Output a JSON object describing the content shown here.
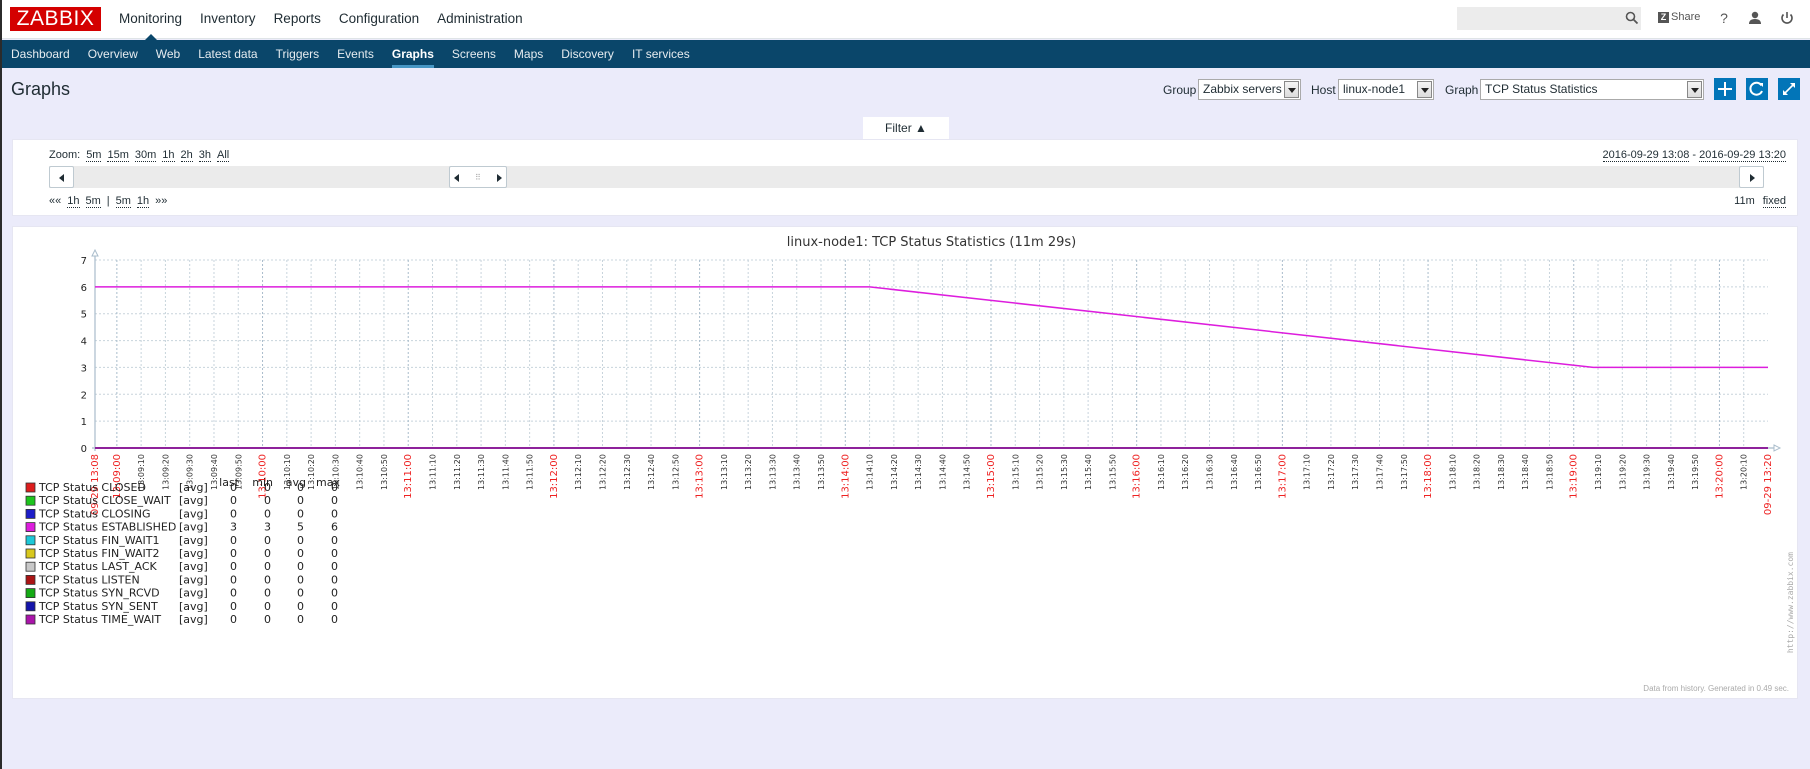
{
  "app": {
    "logo": "ZABBIX",
    "main_nav": [
      "Monitoring",
      "Inventory",
      "Reports",
      "Configuration",
      "Administration"
    ],
    "main_nav_active": "Monitoring",
    "search_placeholder": "",
    "share_label": "Share",
    "help_label": "?",
    "sub_nav": [
      "Dashboard",
      "Overview",
      "Web",
      "Latest data",
      "Triggers",
      "Events",
      "Graphs",
      "Screens",
      "Maps",
      "Discovery",
      "IT services"
    ],
    "sub_nav_active": "Graphs"
  },
  "page": {
    "title": "Graphs",
    "group_label": "Group",
    "group_value": "Zabbix servers",
    "host_label": "Host",
    "host_value": "linux-node1",
    "graph_label": "Graph",
    "graph_value": "TCP Status Statistics",
    "filter_label": "Filter ▲"
  },
  "timeline": {
    "zoom_label": "Zoom:",
    "zoom_options": [
      "5m",
      "15m",
      "30m",
      "1h",
      "2h",
      "3h",
      "All"
    ],
    "range_from": "2016-09-29 13:08",
    "range_sep": " - ",
    "range_to": "2016-09-29 13:20",
    "nav_back": [
      "««",
      "1h",
      "5m"
    ],
    "nav_sep": "|",
    "nav_fwd": [
      "5m",
      "1h",
      "»»"
    ],
    "period": "11m",
    "fixed_label": "fixed"
  },
  "chart_data": {
    "type": "line",
    "title": "linux-node1: TCP Status Statistics (11m 29s)",
    "xlabel": "",
    "ylabel": "",
    "ylim": [
      0,
      7
    ],
    "yticks": [
      0,
      1,
      2,
      3,
      4,
      5,
      6,
      7
    ],
    "x_start": "13:08:51",
    "x_end": "13:20:20",
    "x_start_label": "09-29 13:08",
    "x_end_label": "09-29 13:20",
    "x_tick_interval_seconds": 10,
    "grid": true,
    "series": [
      {
        "name": "TCP Status CLOSED",
        "func": "[avg]",
        "color": "#dd1d1d",
        "last": "0",
        "min": "0",
        "avg": "0",
        "max": "0",
        "points": [
          [
            "13:08:51",
            0
          ],
          [
            "13:20:20",
            0
          ]
        ]
      },
      {
        "name": "TCP Status CLOSE_WAIT",
        "func": "[avg]",
        "color": "#1dc51d",
        "last": "0",
        "min": "0",
        "avg": "0",
        "max": "0",
        "points": [
          [
            "13:08:51",
            0
          ],
          [
            "13:20:20",
            0
          ]
        ]
      },
      {
        "name": "TCP Status CLOSING",
        "func": "[avg]",
        "color": "#1d1dc8",
        "last": "0",
        "min": "0",
        "avg": "0",
        "max": "0",
        "points": [
          [
            "13:08:51",
            0
          ],
          [
            "13:20:20",
            0
          ]
        ]
      },
      {
        "name": "TCP Status ESTABLISHED",
        "func": "[avg]",
        "color": "#dd1ddd",
        "last": "3",
        "min": "3",
        "avg": "5",
        "max": "6",
        "points": [
          [
            "13:08:51",
            6
          ],
          [
            "13:14:10",
            6
          ],
          [
            "13:19:08",
            3
          ],
          [
            "13:20:20",
            3
          ]
        ]
      },
      {
        "name": "TCP Status FIN_WAIT1",
        "func": "[avg]",
        "color": "#1dc8d8",
        "last": "0",
        "min": "0",
        "avg": "0",
        "max": "0",
        "points": [
          [
            "13:08:51",
            0
          ],
          [
            "13:20:20",
            0
          ]
        ]
      },
      {
        "name": "TCP Status FIN_WAIT2",
        "func": "[avg]",
        "color": "#d8c81d",
        "last": "0",
        "min": "0",
        "avg": "0",
        "max": "0",
        "points": [
          [
            "13:08:51",
            0
          ],
          [
            "13:20:20",
            0
          ]
        ]
      },
      {
        "name": "TCP Status LAST_ACK",
        "func": "[avg]",
        "color": "#c8c8c8",
        "last": "0",
        "min": "0",
        "avg": "0",
        "max": "0",
        "points": [
          [
            "13:08:51",
            0
          ],
          [
            "13:20:20",
            0
          ]
        ]
      },
      {
        "name": "TCP Status LISTEN",
        "func": "[avg]",
        "color": "#aa1414",
        "last": "0",
        "min": "0",
        "avg": "0",
        "max": "0",
        "points": [
          [
            "13:08:51",
            0
          ],
          [
            "13:20:20",
            0
          ]
        ]
      },
      {
        "name": "TCP Status SYN_RCVD",
        "func": "[avg]",
        "color": "#14aa14",
        "last": "0",
        "min": "0",
        "avg": "0",
        "max": "0",
        "points": [
          [
            "13:08:51",
            0
          ],
          [
            "13:20:20",
            0
          ]
        ]
      },
      {
        "name": "TCP Status SYN_SENT",
        "func": "[avg]",
        "color": "#1414aa",
        "last": "0",
        "min": "0",
        "avg": "0",
        "max": "0",
        "points": [
          [
            "13:08:51",
            0
          ],
          [
            "13:20:20",
            0
          ]
        ]
      },
      {
        "name": "TCP Status TIME_WAIT",
        "func": "[avg]",
        "color": "#aa14aa",
        "last": "0",
        "min": "0",
        "avg": "0",
        "max": "0",
        "points": [
          [
            "13:08:51",
            0
          ],
          [
            "13:20:20",
            0
          ]
        ]
      }
    ],
    "legend_headers": [
      "last",
      "min",
      "avg",
      "max"
    ],
    "legend_position": "bottom-left",
    "footer": "Data from history. Generated in 0.49 sec.",
    "watermark": "http://www.zabbix.com"
  },
  "colors": {
    "brand": "#d40000",
    "subnav_bg": "#0a466a",
    "accent_button": "#0275b8",
    "page_bg": "#ebebfa",
    "minute_label": "#ee2222",
    "grid": "#b9c8d2"
  }
}
